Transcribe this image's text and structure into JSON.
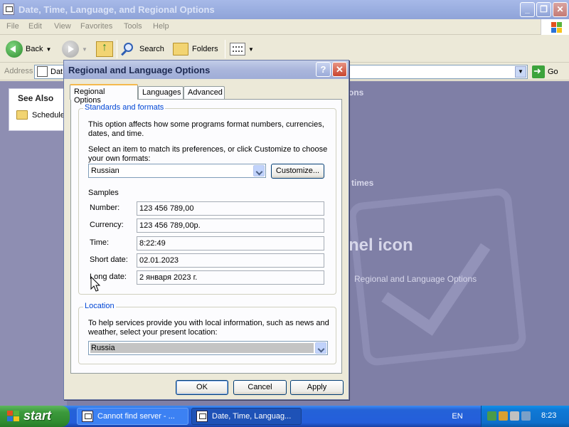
{
  "explorer": {
    "title": "Date, Time, Language, and Regional Options",
    "menu": [
      "File",
      "Edit",
      "View",
      "Favorites",
      "Tools",
      "Help"
    ],
    "toolbar": {
      "back": "Back",
      "search": "Search",
      "folders": "Folders"
    },
    "address": {
      "label": "Address",
      "value": "Dat",
      "go": "Go"
    },
    "see_also": {
      "heading": "See Also",
      "item": "Schedule"
    },
    "background": {
      "fragment_options": "ons",
      "fragment_times": "times",
      "fragment_icon": "nel icon",
      "link": "Regional and Language Options"
    }
  },
  "dialog": {
    "title": "Regional and Language Options",
    "help": "?",
    "close": "X",
    "tabs": [
      "Regional Options",
      "Languages",
      "Advanced"
    ],
    "standards": {
      "legend": "Standards and formats",
      "desc_1": "This option affects how some programs format numbers, currencies,",
      "desc_2": "dates, and time.",
      "select_1": "Select an item to match its preferences, or click Customize to choose",
      "select_2": "your own formats:",
      "selected_format": "Russian",
      "customize": "Customize...",
      "samples_label": "Samples",
      "samples": [
        {
          "label": "Number:",
          "value": "123 456 789,00"
        },
        {
          "label": "Currency:",
          "value": "123 456 789,00р."
        },
        {
          "label": "Time:",
          "value": "8:22:49"
        },
        {
          "label": "Short date:",
          "value": "02.01.2023"
        },
        {
          "label": "Long date:",
          "value": "2 января 2023 г."
        }
      ]
    },
    "location": {
      "legend": "Location",
      "desc_1": "To help services provide you with local information, such as news and",
      "desc_2": "weather, select your present location:",
      "value": "Russia"
    },
    "buttons": {
      "ok": "OK",
      "cancel": "Cancel",
      "apply": "Apply"
    }
  },
  "taskbar": {
    "start": "start",
    "tasks": [
      "Cannot find server - ...",
      "Date, Time, Languag..."
    ],
    "language": "EN",
    "clock": "8:23"
  }
}
